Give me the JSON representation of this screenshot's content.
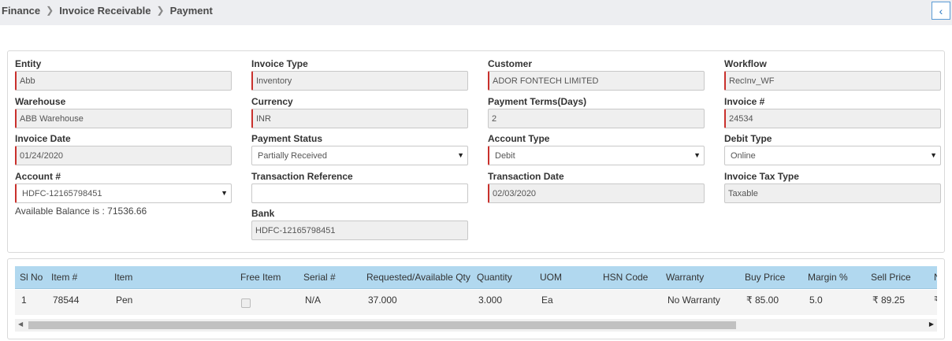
{
  "breadcrumb": {
    "items": [
      "Finance",
      "Invoice Receivable",
      "Payment"
    ]
  },
  "collapse_button": {
    "icon": "chevron-left-icon",
    "glyph": "‹"
  },
  "form": {
    "entity": {
      "label": "Entity",
      "value": "Abb"
    },
    "invoice_type": {
      "label": "Invoice Type",
      "value": "Inventory"
    },
    "customer": {
      "label": "Customer",
      "value": "ADOR FONTECH LIMITED"
    },
    "workflow": {
      "label": "Workflow",
      "value": "RecInv_WF"
    },
    "warehouse": {
      "label": "Warehouse",
      "value": "ABB Warehouse"
    },
    "currency": {
      "label": "Currency",
      "value": "INR"
    },
    "payment_terms": {
      "label": "Payment Terms(Days)",
      "value": "2"
    },
    "invoice_no": {
      "label": "Invoice #",
      "value": "24534"
    },
    "invoice_date": {
      "label": "Invoice Date",
      "value": "01/24/2020"
    },
    "payment_status": {
      "label": "Payment Status",
      "value": "Partially Received"
    },
    "account_type": {
      "label": "Account Type",
      "value": "Debit"
    },
    "debit_type": {
      "label": "Debit Type",
      "value": "Online"
    },
    "account_no": {
      "label": "Account #",
      "value": "HDFC-12165798451"
    },
    "transaction_reference": {
      "label": "Transaction Reference",
      "value": ""
    },
    "transaction_date": {
      "label": "Transaction Date",
      "value": "02/03/2020"
    },
    "invoice_tax_type": {
      "label": "Invoice Tax Type",
      "value": "Taxable"
    },
    "available_balance": "Available Balance is : 71536.66",
    "bank": {
      "label": "Bank",
      "value": "HDFC-12165798451"
    }
  },
  "items_table": {
    "columns": [
      "Sl No",
      "Item #",
      "Item",
      "Free Item",
      "Serial #",
      "Requested/Available Qty",
      "Quantity",
      "UOM",
      "HSN Code",
      "Warranty",
      "Buy Price",
      "Margin %",
      "Sell Price",
      "N"
    ],
    "rows": [
      {
        "sl_no": "1",
        "item_no": "78544",
        "item": "Pen",
        "free_item": false,
        "serial": "N/A",
        "req_avail_qty": "37.000",
        "quantity": "3.000",
        "uom": "Ea",
        "hsn_code": "",
        "warranty": "No Warranty",
        "buy_price": "₹ 85.00",
        "margin": "5.0",
        "sell_price": "₹ 89.25",
        "next": "₹"
      }
    ]
  },
  "scrollbar": {
    "position": 0.0
  },
  "colors": {
    "header_bg": "#b1d8ef",
    "required_border": "#c9302c",
    "topbar_bg": "#edeef1"
  }
}
